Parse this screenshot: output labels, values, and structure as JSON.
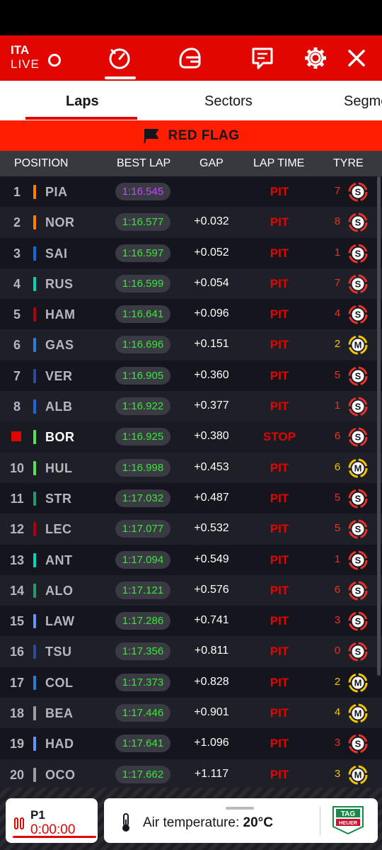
{
  "header": {
    "session_code": "ITA",
    "session_status": "LIVE"
  },
  "tabs": [
    {
      "label": "Laps",
      "active": true
    },
    {
      "label": "Sectors",
      "active": false
    },
    {
      "label": "Segments",
      "active": false
    }
  ],
  "flag_banner": {
    "label": "RED FLAG"
  },
  "table": {
    "columns": [
      "POSITION",
      "BEST LAP",
      "GAP",
      "LAP TIME",
      "TYRE"
    ],
    "rows": [
      {
        "pos": "1",
        "code": "PIA",
        "team_color": "#ff8000",
        "best": "1:16.545",
        "best_color": "#c54bff",
        "gap": "",
        "lap": "PIT",
        "tyre_laps": "7",
        "tyre": "S"
      },
      {
        "pos": "2",
        "code": "NOR",
        "team_color": "#ff8000",
        "best": "1:16.577",
        "best_color": "#39e639",
        "gap": "+0.032",
        "lap": "PIT",
        "tyre_laps": "8",
        "tyre": "S"
      },
      {
        "pos": "3",
        "code": "SAI",
        "team_color": "#1868db",
        "best": "1:16.597",
        "best_color": "#39e639",
        "gap": "+0.052",
        "lap": "PIT",
        "tyre_laps": "1",
        "tyre": "S"
      },
      {
        "pos": "4",
        "code": "RUS",
        "team_color": "#00d7b6",
        "best": "1:16.599",
        "best_color": "#39e639",
        "gap": "+0.054",
        "lap": "PIT",
        "tyre_laps": "7",
        "tyre": "S"
      },
      {
        "pos": "5",
        "code": "HAM",
        "team_color": "#b00010",
        "best": "1:16.641",
        "best_color": "#39e639",
        "gap": "+0.096",
        "lap": "PIT",
        "tyre_laps": "4",
        "tyre": "S"
      },
      {
        "pos": "6",
        "code": "GAS",
        "team_color": "#2a7fd4",
        "best": "1:16.696",
        "best_color": "#39e639",
        "gap": "+0.151",
        "lap": "PIT",
        "tyre_laps": "2",
        "tyre": "M"
      },
      {
        "pos": "7",
        "code": "VER",
        "team_color": "#2c4a9b",
        "best": "1:16.905",
        "best_color": "#39e639",
        "gap": "+0.360",
        "lap": "PIT",
        "tyre_laps": "5",
        "tyre": "S"
      },
      {
        "pos": "8",
        "code": "ALB",
        "team_color": "#1868db",
        "best": "1:16.922",
        "best_color": "#39e639",
        "gap": "+0.377",
        "lap": "PIT",
        "tyre_laps": "1",
        "tyre": "S"
      },
      {
        "pos": "",
        "code": "BOR",
        "team_color": "#52e252",
        "best": "1:16.925",
        "best_color": "#39e639",
        "gap": "+0.380",
        "lap": "STOP",
        "tyre_laps": "6",
        "tyre": "S",
        "stopped": true
      },
      {
        "pos": "10",
        "code": "HUL",
        "team_color": "#52e252",
        "best": "1:16.998",
        "best_color": "#39e639",
        "gap": "+0.453",
        "lap": "PIT",
        "tyre_laps": "6",
        "tyre": "M"
      },
      {
        "pos": "11",
        "code": "STR",
        "team_color": "#229971",
        "best": "1:17.032",
        "best_color": "#39e639",
        "gap": "+0.487",
        "lap": "PIT",
        "tyre_laps": "5",
        "tyre": "S"
      },
      {
        "pos": "12",
        "code": "LEC",
        "team_color": "#b00010",
        "best": "1:17.077",
        "best_color": "#39e639",
        "gap": "+0.532",
        "lap": "PIT",
        "tyre_laps": "5",
        "tyre": "S"
      },
      {
        "pos": "13",
        "code": "ANT",
        "team_color": "#00d7b6",
        "best": "1:17.094",
        "best_color": "#39e639",
        "gap": "+0.549",
        "lap": "PIT",
        "tyre_laps": "1",
        "tyre": "S"
      },
      {
        "pos": "14",
        "code": "ALO",
        "team_color": "#229971",
        "best": "1:17.121",
        "best_color": "#39e639",
        "gap": "+0.576",
        "lap": "PIT",
        "tyre_laps": "6",
        "tyre": "S"
      },
      {
        "pos": "15",
        "code": "LAW",
        "team_color": "#6692ff",
        "best": "1:17.286",
        "best_color": "#39e639",
        "gap": "+0.741",
        "lap": "PIT",
        "tyre_laps": "3",
        "tyre": "S"
      },
      {
        "pos": "16",
        "code": "TSU",
        "team_color": "#2c4a9b",
        "best": "1:17.356",
        "best_color": "#39e639",
        "gap": "+0.811",
        "lap": "PIT",
        "tyre_laps": "0",
        "tyre": "S"
      },
      {
        "pos": "17",
        "code": "COL",
        "team_color": "#2a7fd4",
        "best": "1:17.373",
        "best_color": "#39e639",
        "gap": "+0.828",
        "lap": "PIT",
        "tyre_laps": "2",
        "tyre": "M"
      },
      {
        "pos": "18",
        "code": "BEA",
        "team_color": "#9c9fa2",
        "best": "1:17.446",
        "best_color": "#39e639",
        "gap": "+0.901",
        "lap": "PIT",
        "tyre_laps": "4",
        "tyre": "M"
      },
      {
        "pos": "19",
        "code": "HAD",
        "team_color": "#6692ff",
        "best": "1:17.641",
        "best_color": "#39e639",
        "gap": "+1.096",
        "lap": "PIT",
        "tyre_laps": "3",
        "tyre": "S"
      },
      {
        "pos": "20",
        "code": "OCO",
        "team_color": "#9c9fa2",
        "best": "1:17.662",
        "best_color": "#39e639",
        "gap": "+1.117",
        "lap": "PIT",
        "tyre_laps": "3",
        "tyre": "M"
      }
    ]
  },
  "footer": {
    "position_label": "P1",
    "timer": "0:00:00",
    "weather_label": "Air temperature: ",
    "weather_value": "20°C",
    "sponsor_top": "TAG",
    "sponsor_bottom": "HEUER"
  },
  "colors": {
    "accent": "#e10600",
    "soft_tyre": "#e8322a",
    "medium_tyre": "#f5c400",
    "fastest_lap": "#c54bff",
    "personal_best": "#39e639"
  }
}
